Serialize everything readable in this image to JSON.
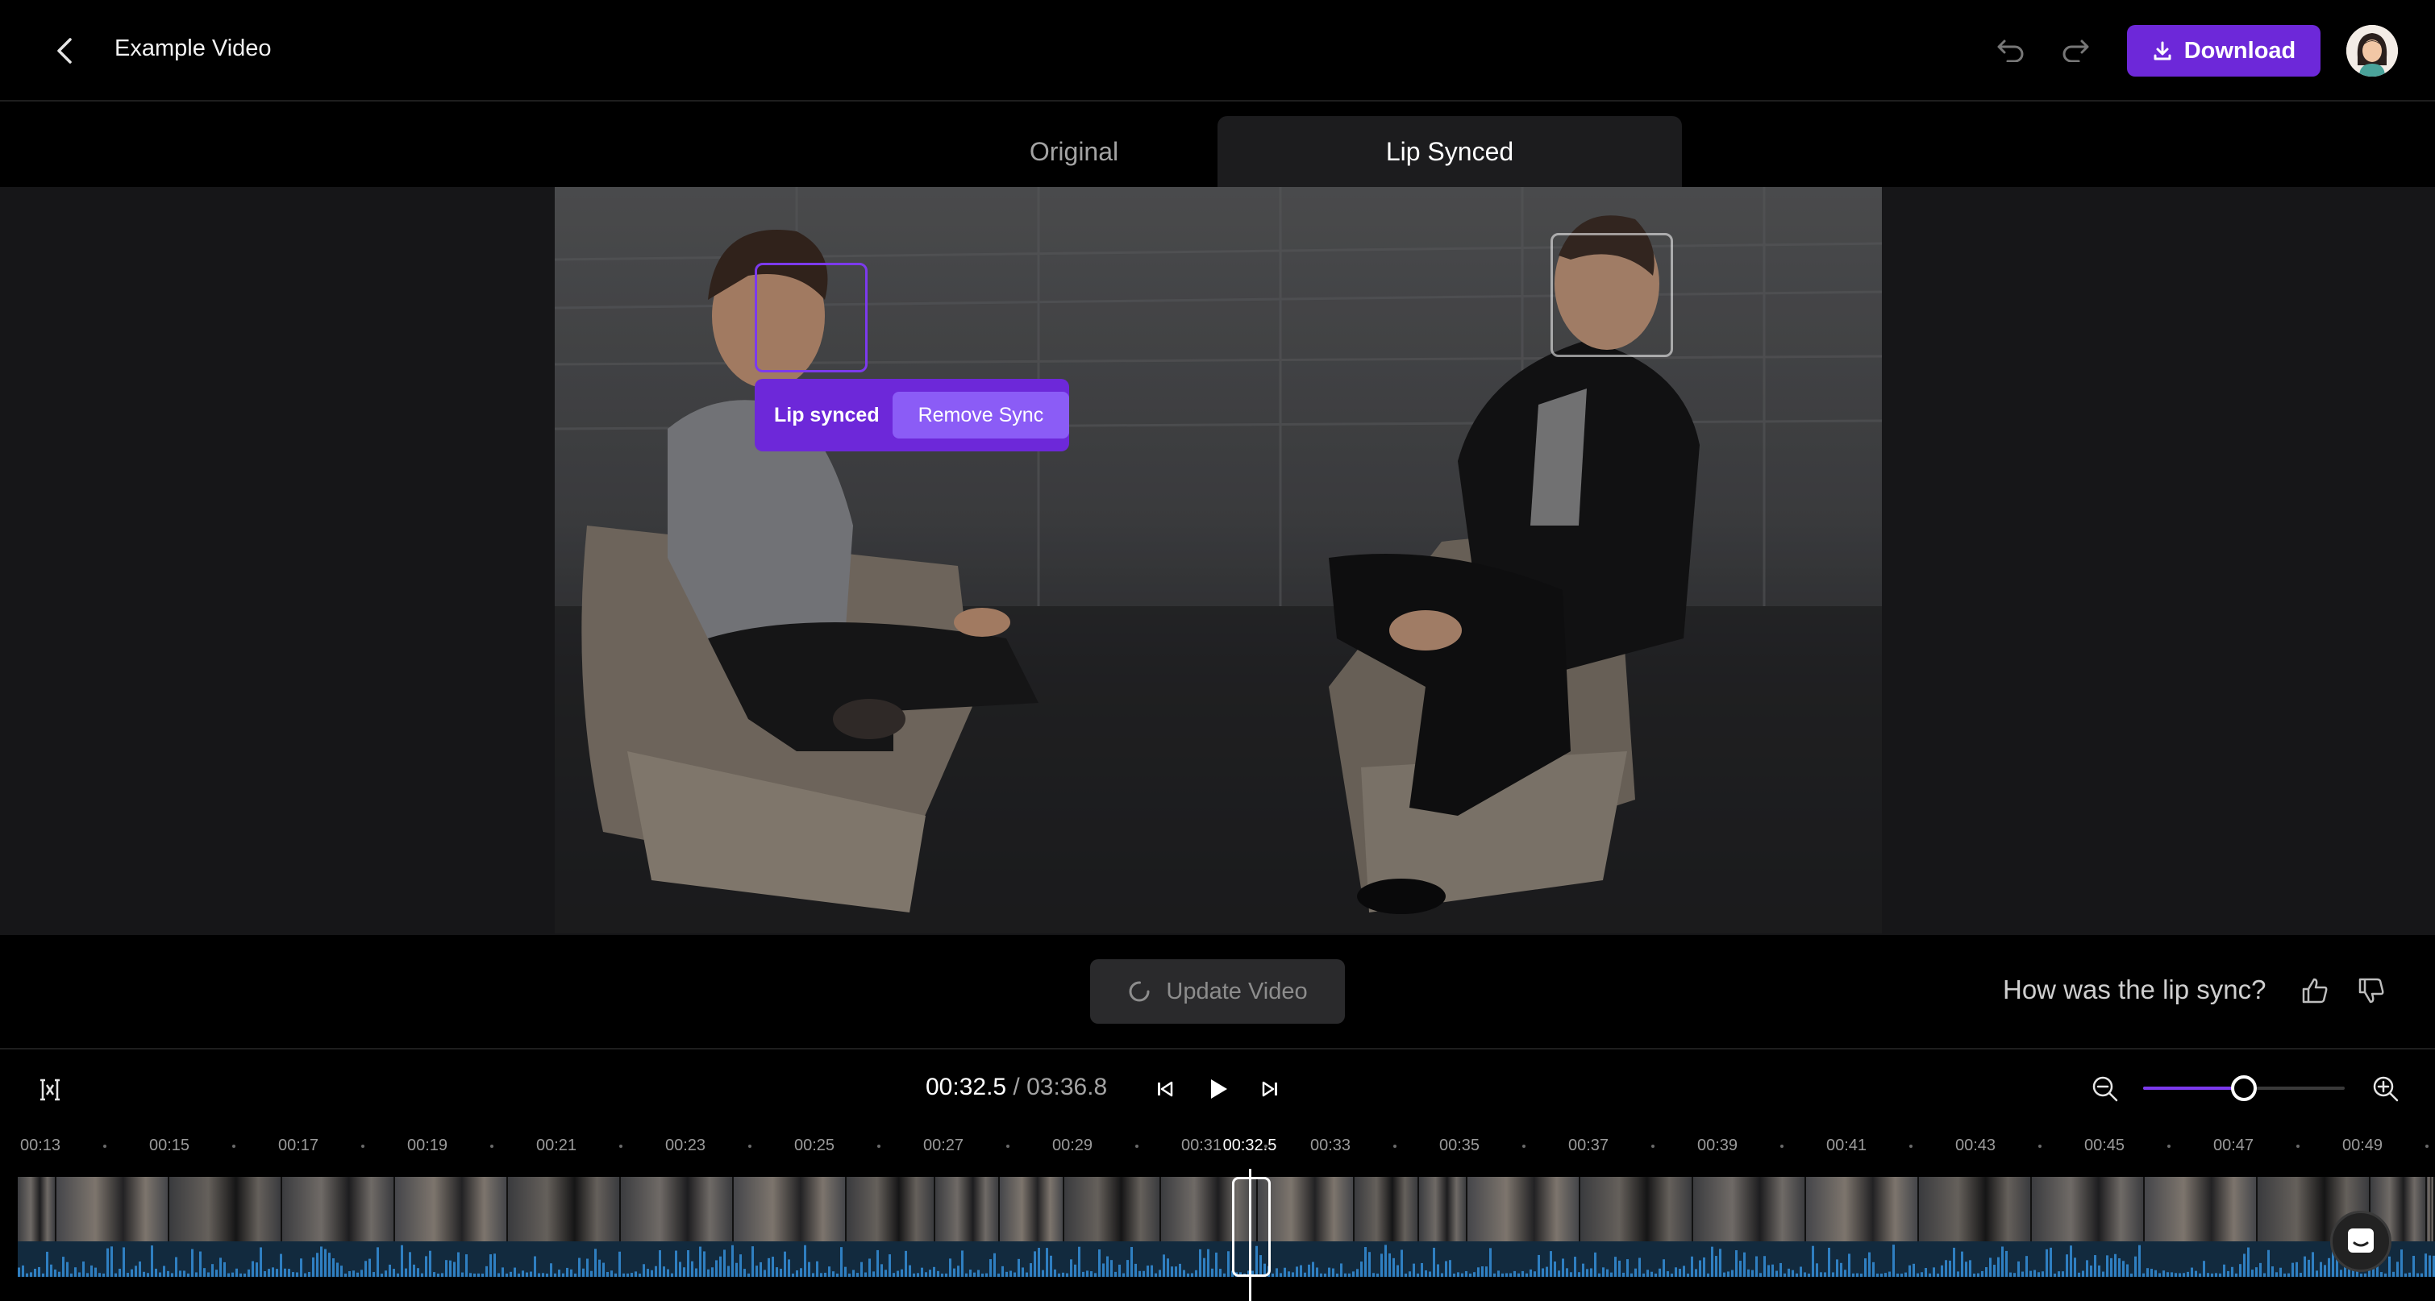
{
  "header": {
    "title": "Example Video",
    "download_label": "Download",
    "icons": {
      "back": "chevron-left-icon",
      "undo": "undo-icon",
      "redo": "redo-icon",
      "download": "download-icon"
    }
  },
  "tabs": [
    {
      "label": "Original",
      "active": false
    },
    {
      "label": "Lip Synced",
      "active": true
    }
  ],
  "video": {
    "popup": {
      "status_label": "Lip synced",
      "remove_label": "Remove Sync"
    }
  },
  "actions": {
    "update_label": "Update Video",
    "feedback_question": "How was the lip sync?"
  },
  "player": {
    "current_time": "00:32.5",
    "separator": " / ",
    "total_time": "03:36.8",
    "zoom_level": 0.5
  },
  "timeline": {
    "ticks": [
      "00:13",
      "00:15",
      "00:17",
      "00:19",
      "00:21",
      "00:23",
      "00:25",
      "00:27",
      "00:29",
      "00:31",
      "00:33",
      "00:35",
      "00:37",
      "00:39",
      "00:41",
      "00:43",
      "00:45",
      "00:47",
      "00:49"
    ],
    "playhead_label": "00:32.5"
  },
  "colors": {
    "accent": "#6d28d9",
    "accent_light": "#8b5cf6",
    "background": "#000000",
    "stage": "#161618"
  }
}
